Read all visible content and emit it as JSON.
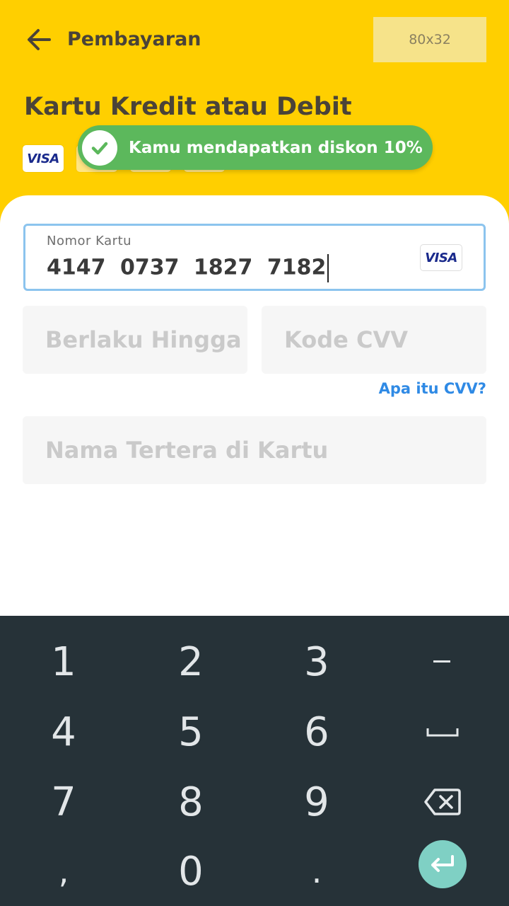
{
  "header": {
    "title": "Pembayaran",
    "placeholder_image_label": "80x32"
  },
  "payment_method": {
    "title": "Kartu Kredit atau Debit",
    "card_logos": [
      "VISA"
    ]
  },
  "toast": {
    "message": "Kamu mendapatkan diskon 10%"
  },
  "form": {
    "card_number": {
      "label": "Nomor Kartu",
      "value": "4147 0737 1827 7182",
      "brand": "VISA"
    },
    "expiry_placeholder": "Berlaku Hingga",
    "cvv_placeholder": "Kode CVV",
    "cvv_help_link": "Apa itu CVV?",
    "name_placeholder": "Nama Tertera di Kartu"
  },
  "keypad": {
    "keys": [
      "1",
      "2",
      "3",
      "–",
      "4",
      "5",
      "6",
      "␣",
      "7",
      "8",
      "9",
      "⌫",
      ",",
      "0",
      ".",
      "↵"
    ],
    "row1": [
      "1",
      "2",
      "3",
      "–"
    ],
    "row2": [
      "4",
      "5",
      "6"
    ],
    "row3": [
      "7",
      "8",
      "9"
    ],
    "row4": [
      ",",
      "0",
      "."
    ]
  },
  "colors": {
    "header_bg": "#ffcf00",
    "toast_bg": "#5cb85c",
    "focus_border": "#8cc4ee",
    "link": "#2f8ae5",
    "keypad_bg": "#263238",
    "enter_key": "#7fd0c4"
  },
  "icons": {
    "back": "arrow-left-icon",
    "toast": "check-circle-icon",
    "space": "space-bar-icon",
    "backspace": "backspace-icon",
    "enter": "enter-return-icon"
  }
}
